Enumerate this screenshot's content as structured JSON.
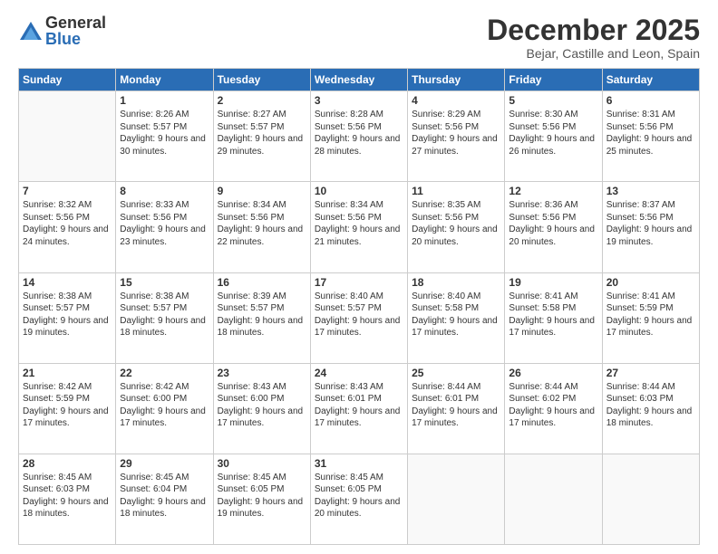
{
  "logo": {
    "general": "General",
    "blue": "Blue"
  },
  "header": {
    "month": "December 2025",
    "location": "Bejar, Castille and Leon, Spain"
  },
  "weekdays": [
    "Sunday",
    "Monday",
    "Tuesday",
    "Wednesday",
    "Thursday",
    "Friday",
    "Saturday"
  ],
  "weeks": [
    [
      {
        "day": "",
        "sunrise": "",
        "sunset": "",
        "daylight": ""
      },
      {
        "day": "1",
        "sunrise": "Sunrise: 8:26 AM",
        "sunset": "Sunset: 5:57 PM",
        "daylight": "Daylight: 9 hours and 30 minutes."
      },
      {
        "day": "2",
        "sunrise": "Sunrise: 8:27 AM",
        "sunset": "Sunset: 5:57 PM",
        "daylight": "Daylight: 9 hours and 29 minutes."
      },
      {
        "day": "3",
        "sunrise": "Sunrise: 8:28 AM",
        "sunset": "Sunset: 5:56 PM",
        "daylight": "Daylight: 9 hours and 28 minutes."
      },
      {
        "day": "4",
        "sunrise": "Sunrise: 8:29 AM",
        "sunset": "Sunset: 5:56 PM",
        "daylight": "Daylight: 9 hours and 27 minutes."
      },
      {
        "day": "5",
        "sunrise": "Sunrise: 8:30 AM",
        "sunset": "Sunset: 5:56 PM",
        "daylight": "Daylight: 9 hours and 26 minutes."
      },
      {
        "day": "6",
        "sunrise": "Sunrise: 8:31 AM",
        "sunset": "Sunset: 5:56 PM",
        "daylight": "Daylight: 9 hours and 25 minutes."
      }
    ],
    [
      {
        "day": "7",
        "sunrise": "Sunrise: 8:32 AM",
        "sunset": "Sunset: 5:56 PM",
        "daylight": "Daylight: 9 hours and 24 minutes."
      },
      {
        "day": "8",
        "sunrise": "Sunrise: 8:33 AM",
        "sunset": "Sunset: 5:56 PM",
        "daylight": "Daylight: 9 hours and 23 minutes."
      },
      {
        "day": "9",
        "sunrise": "Sunrise: 8:34 AM",
        "sunset": "Sunset: 5:56 PM",
        "daylight": "Daylight: 9 hours and 22 minutes."
      },
      {
        "day": "10",
        "sunrise": "Sunrise: 8:34 AM",
        "sunset": "Sunset: 5:56 PM",
        "daylight": "Daylight: 9 hours and 21 minutes."
      },
      {
        "day": "11",
        "sunrise": "Sunrise: 8:35 AM",
        "sunset": "Sunset: 5:56 PM",
        "daylight": "Daylight: 9 hours and 20 minutes."
      },
      {
        "day": "12",
        "sunrise": "Sunrise: 8:36 AM",
        "sunset": "Sunset: 5:56 PM",
        "daylight": "Daylight: 9 hours and 20 minutes."
      },
      {
        "day": "13",
        "sunrise": "Sunrise: 8:37 AM",
        "sunset": "Sunset: 5:56 PM",
        "daylight": "Daylight: 9 hours and 19 minutes."
      }
    ],
    [
      {
        "day": "14",
        "sunrise": "Sunrise: 8:38 AM",
        "sunset": "Sunset: 5:57 PM",
        "daylight": "Daylight: 9 hours and 19 minutes."
      },
      {
        "day": "15",
        "sunrise": "Sunrise: 8:38 AM",
        "sunset": "Sunset: 5:57 PM",
        "daylight": "Daylight: 9 hours and 18 minutes."
      },
      {
        "day": "16",
        "sunrise": "Sunrise: 8:39 AM",
        "sunset": "Sunset: 5:57 PM",
        "daylight": "Daylight: 9 hours and 18 minutes."
      },
      {
        "day": "17",
        "sunrise": "Sunrise: 8:40 AM",
        "sunset": "Sunset: 5:57 PM",
        "daylight": "Daylight: 9 hours and 17 minutes."
      },
      {
        "day": "18",
        "sunrise": "Sunrise: 8:40 AM",
        "sunset": "Sunset: 5:58 PM",
        "daylight": "Daylight: 9 hours and 17 minutes."
      },
      {
        "day": "19",
        "sunrise": "Sunrise: 8:41 AM",
        "sunset": "Sunset: 5:58 PM",
        "daylight": "Daylight: 9 hours and 17 minutes."
      },
      {
        "day": "20",
        "sunrise": "Sunrise: 8:41 AM",
        "sunset": "Sunset: 5:59 PM",
        "daylight": "Daylight: 9 hours and 17 minutes."
      }
    ],
    [
      {
        "day": "21",
        "sunrise": "Sunrise: 8:42 AM",
        "sunset": "Sunset: 5:59 PM",
        "daylight": "Daylight: 9 hours and 17 minutes."
      },
      {
        "day": "22",
        "sunrise": "Sunrise: 8:42 AM",
        "sunset": "Sunset: 6:00 PM",
        "daylight": "Daylight: 9 hours and 17 minutes."
      },
      {
        "day": "23",
        "sunrise": "Sunrise: 8:43 AM",
        "sunset": "Sunset: 6:00 PM",
        "daylight": "Daylight: 9 hours and 17 minutes."
      },
      {
        "day": "24",
        "sunrise": "Sunrise: 8:43 AM",
        "sunset": "Sunset: 6:01 PM",
        "daylight": "Daylight: 9 hours and 17 minutes."
      },
      {
        "day": "25",
        "sunrise": "Sunrise: 8:44 AM",
        "sunset": "Sunset: 6:01 PM",
        "daylight": "Daylight: 9 hours and 17 minutes."
      },
      {
        "day": "26",
        "sunrise": "Sunrise: 8:44 AM",
        "sunset": "Sunset: 6:02 PM",
        "daylight": "Daylight: 9 hours and 17 minutes."
      },
      {
        "day": "27",
        "sunrise": "Sunrise: 8:44 AM",
        "sunset": "Sunset: 6:03 PM",
        "daylight": "Daylight: 9 hours and 18 minutes."
      }
    ],
    [
      {
        "day": "28",
        "sunrise": "Sunrise: 8:45 AM",
        "sunset": "Sunset: 6:03 PM",
        "daylight": "Daylight: 9 hours and 18 minutes."
      },
      {
        "day": "29",
        "sunrise": "Sunrise: 8:45 AM",
        "sunset": "Sunset: 6:04 PM",
        "daylight": "Daylight: 9 hours and 18 minutes."
      },
      {
        "day": "30",
        "sunrise": "Sunrise: 8:45 AM",
        "sunset": "Sunset: 6:05 PM",
        "daylight": "Daylight: 9 hours and 19 minutes."
      },
      {
        "day": "31",
        "sunrise": "Sunrise: 8:45 AM",
        "sunset": "Sunset: 6:05 PM",
        "daylight": "Daylight: 9 hours and 20 minutes."
      },
      {
        "day": "",
        "sunrise": "",
        "sunset": "",
        "daylight": ""
      },
      {
        "day": "",
        "sunrise": "",
        "sunset": "",
        "daylight": ""
      },
      {
        "day": "",
        "sunrise": "",
        "sunset": "",
        "daylight": ""
      }
    ]
  ]
}
